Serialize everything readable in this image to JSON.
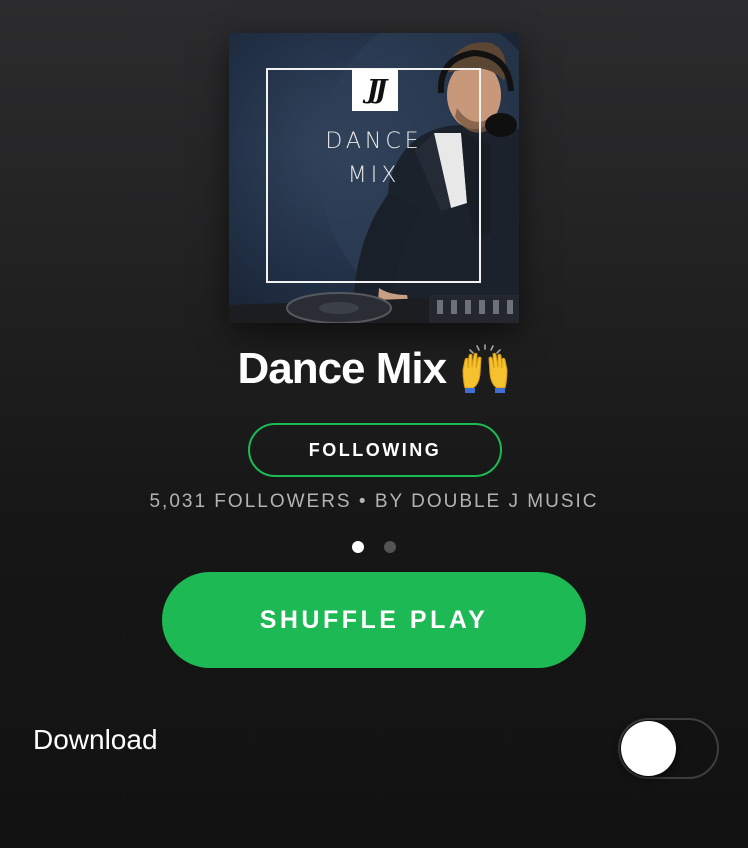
{
  "playlist": {
    "cover": {
      "logo_text": "JJ",
      "title_line1": "DANCE",
      "title_line2": "MIX"
    },
    "title": "Dance Mix",
    "title_emoji": "raising-hands-emoji",
    "follow_button_label": "FOLLOWING",
    "meta_text": "5,031 FOLLOWERS • BY DOUBLE J MUSIC",
    "page_indicator": {
      "current": 1,
      "total": 2
    },
    "shuffle_button_label": "SHUFFLE PLAY"
  },
  "download": {
    "label": "Download",
    "enabled": false
  },
  "colors": {
    "accent": "#1db954",
    "background": "#121212",
    "secondary_text": "#b3b3b3"
  }
}
